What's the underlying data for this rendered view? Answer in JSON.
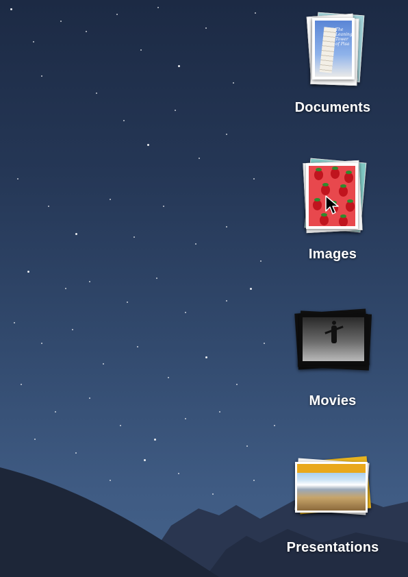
{
  "desktop": {
    "stacks": [
      {
        "label": "Documents",
        "icon": "documents-stack-icon",
        "cover_text": "The Leaning Tower of Pisa"
      },
      {
        "label": "Images",
        "icon": "images-stack-icon"
      },
      {
        "label": "Movies",
        "icon": "movies-stack-icon"
      },
      {
        "label": "Presentations",
        "icon": "presentations-stack-icon"
      }
    ]
  },
  "cursor": {
    "icon": "arrow-cursor-icon"
  },
  "colors": {
    "sky_top": "#1c2a44",
    "sky_bottom": "#44628a",
    "label_text": "#ffffff"
  }
}
